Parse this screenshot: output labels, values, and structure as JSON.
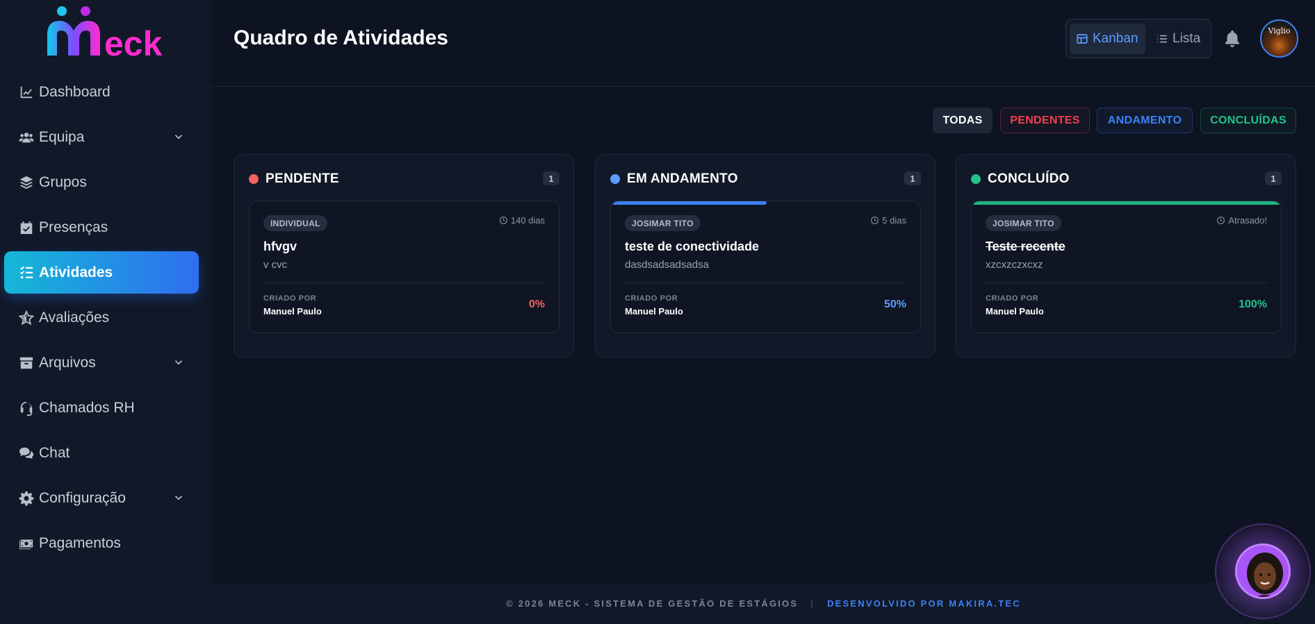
{
  "brand": {
    "logo_text": "eck",
    "colors": {
      "accent": "#3b82f6",
      "pink": "#e024c8",
      "cyan": "#14b8d6"
    }
  },
  "sidebar": {
    "items": [
      {
        "label": "Dashboard",
        "icon": "chart-line-icon",
        "has_chevron": false
      },
      {
        "label": "Equipa",
        "icon": "users-icon",
        "has_chevron": true
      },
      {
        "label": "Grupos",
        "icon": "layers-icon",
        "has_chevron": false
      },
      {
        "label": "Presenças",
        "icon": "calendar-check-icon",
        "has_chevron": false
      },
      {
        "label": "Atividades",
        "icon": "list-check-icon",
        "has_chevron": false,
        "active": true
      },
      {
        "label": "Avaliações",
        "icon": "star-icon",
        "has_chevron": false
      },
      {
        "label": "Arquivos",
        "icon": "archive-icon",
        "has_chevron": true
      },
      {
        "label": "Chamados RH",
        "icon": "headset-icon",
        "has_chevron": false
      },
      {
        "label": "Chat",
        "icon": "comments-icon",
        "has_chevron": false
      },
      {
        "label": "Configuração",
        "icon": "gear-icon",
        "has_chevron": true
      },
      {
        "label": "Pagamentos",
        "icon": "money-icon",
        "has_chevron": false
      }
    ]
  },
  "header": {
    "title": "Quadro de Atividades",
    "view_kanban": "Kanban",
    "view_lista": "Lista",
    "avatar_text": "Viglio"
  },
  "filters": {
    "todas": "TODAS",
    "pendentes": "PENDENTES",
    "andamento": "ANDAMENTO",
    "concluidas": "CONCLUÍDAS"
  },
  "columns": [
    {
      "title": "PENDENTE",
      "count": "1",
      "color": "#f2645f",
      "card": {
        "tag": "INDIVIDUAL",
        "due": "140 dias",
        "title": "hfvgv",
        "desc": "v cvc",
        "created_label": "CRIADO POR",
        "created_by": "Manuel Paulo",
        "progress": "0%",
        "progress_value": 0,
        "progress_color": "#f2645f"
      }
    },
    {
      "title": "EM ANDAMENTO",
      "count": "1",
      "color": "#5b9dff",
      "card": {
        "tag": "JOSIMAR TITO",
        "due": "5 dias",
        "title": "teste de conectividade",
        "desc": "dasdsadsadsadsa",
        "created_label": "CRIADO POR",
        "created_by": "Manuel Paulo",
        "progress": "50%",
        "progress_value": 0.5,
        "progress_color": "#5b9dff"
      }
    },
    {
      "title": "CONCLUÍDO",
      "count": "1",
      "color": "#22c28d",
      "card": {
        "tag": "JOSIMAR TITO",
        "due": "Atrasado!",
        "title": "Teste recente",
        "desc": "xzcxzczxcxz",
        "created_label": "CRIADO POR",
        "created_by": "Manuel Paulo",
        "progress": "100%",
        "progress_value": 1,
        "progress_color": "#22c28d"
      }
    }
  ],
  "footer": {
    "copyright": "© 2026 MECK - SISTEMA DE GESTÃO DE ESTÁGIOS",
    "separator": "|",
    "developer": "DESENVOLVIDO POR MAKIRA.TEC"
  }
}
